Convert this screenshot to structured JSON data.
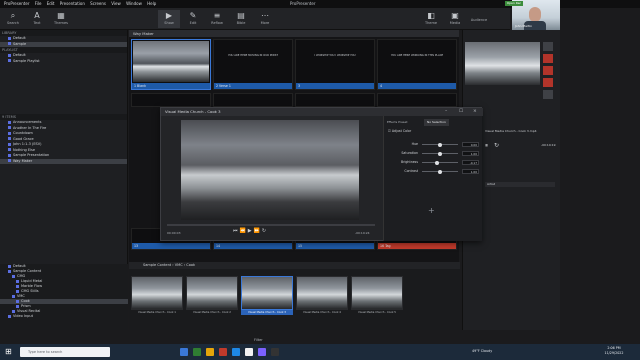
{
  "app": {
    "name": "ProPresenter",
    "window_title": "ProPresenter",
    "menu": [
      "ProPresenter",
      "File",
      "Edit",
      "Presentation",
      "Screens",
      "View",
      "Window",
      "Help"
    ]
  },
  "toolbar": {
    "buttons": [
      "Show",
      "Edit",
      "Reflow",
      "Bible",
      "More",
      "Theme",
      "Text",
      "Media",
      "Audience"
    ],
    "left_buttons": [
      "Search",
      "Text",
      "Themes"
    ],
    "open_rec": "Open Rec"
  },
  "library": {
    "header_library": "LIBRARY",
    "items_library": [
      "Default",
      "Sample"
    ],
    "header_playlist": "PLAYLIST",
    "items_playlist": [
      "Default",
      "Sample Playlist"
    ],
    "header_items": "9 ITEMS",
    "items": [
      "Announcements",
      "Another In The Fire",
      "Countdown",
      "Good Grace",
      "John 1:1-3 (ESV)",
      "Nothing Else",
      "Sample Presentation",
      "Way Maker"
    ]
  },
  "slides": {
    "header": "Way Maker",
    "items": [
      {
        "num": "1",
        "label": "Blank",
        "type": "photo"
      },
      {
        "num": "2",
        "label": "Verse 1",
        "text": "YOU ARE HERE MOVING IN OUR MIDST"
      },
      {
        "num": "3",
        "label": "",
        "text": "I WORSHIP YOU I WORSHIP YOU"
      },
      {
        "num": "4",
        "label": "",
        "text": "YOU ARE HERE WORKING IN THIS PLACE"
      }
    ],
    "lower": [
      {
        "num": "13",
        "label": ""
      },
      {
        "num": "14",
        "label": ""
      },
      {
        "num": "15",
        "label": ""
      },
      {
        "num": "16",
        "label": "Tag"
      }
    ]
  },
  "visual_media": {
    "title": "Visual Media Church - Cook 3",
    "time_start": "00:00:03",
    "time_end": "-00:19:24",
    "tabs": [
      "Effects Preset",
      "No Selection"
    ],
    "adjust_color": "Adjust Color",
    "controls": [
      {
        "name": "Hue",
        "value": "0.00",
        "level": 0.5
      },
      {
        "name": "Saturation",
        "value": "1.00",
        "level": 0.5
      },
      {
        "name": "Brightness",
        "value": "-0.17",
        "level": 0.42
      },
      {
        "name": "Contrast",
        "value": "1.00",
        "level": 0.5
      }
    ]
  },
  "right_panel": {
    "preview_label": "Visual Media Church - Cook 3.mp4",
    "time": "-00:19:19"
  },
  "media_bin": {
    "breadcrumb": [
      "Sample Content",
      "VMC",
      "Cook"
    ],
    "thumbs": [
      {
        "label": "Visual Media Church - Cook 1"
      },
      {
        "label": "Visual Media Church - Cook 2"
      },
      {
        "label": "Visual Media Church - Cook 3",
        "selected": true
      },
      {
        "label": "Visual Media Church - Cook 4"
      },
      {
        "label": "Visual Media Church - Cook 5"
      }
    ],
    "filter_label": "Filter"
  },
  "media_tree": {
    "items": [
      "Default",
      "Sample Content",
      "CMG",
      "Liquid Metal",
      "Marble Flow",
      "CMG Stills",
      "VMC",
      "Cook",
      "Prism",
      "Visual Recital",
      "Video Input"
    ]
  },
  "webcam": {
    "name": "John Martin"
  },
  "taskbar": {
    "search_placeholder": "Type here to search",
    "weather": "49°F Cloudy",
    "time": "2:06 PM",
    "date": "11/29/2022"
  },
  "colors": {
    "accent": "#1e5aa8",
    "record": "#c03a2b",
    "selected_border": "#3a78d8"
  }
}
